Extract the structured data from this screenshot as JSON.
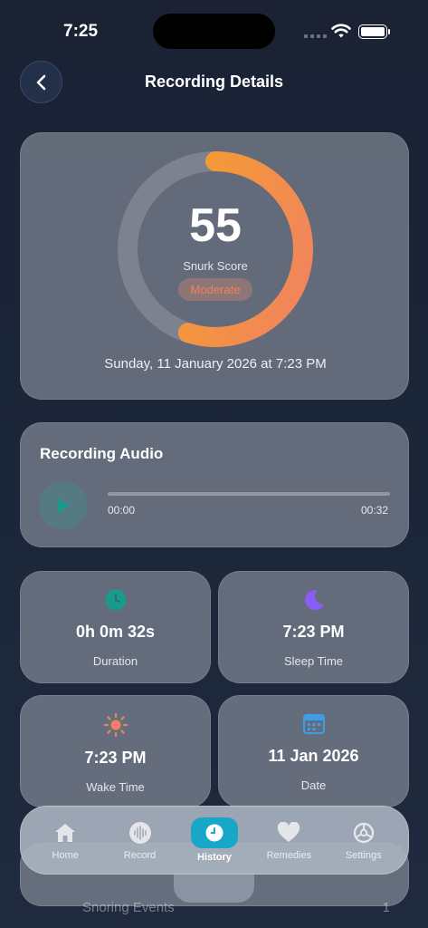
{
  "status_bar": {
    "time": "7:25"
  },
  "header": {
    "title": "Recording Details"
  },
  "score": {
    "value": "55",
    "label": "Snurk Score",
    "severity": "Moderate",
    "gauge_fraction": 0.55,
    "recorded_at": "Sunday, 11 January 2026 at 7:23 PM"
  },
  "audio": {
    "title": "Recording Audio",
    "current_time": "00:00",
    "total_time": "00:32",
    "progress": 0
  },
  "stats": [
    {
      "icon": "clock-icon",
      "value": "0h 0m 32s",
      "label": "Duration"
    },
    {
      "icon": "moon-icon",
      "value": "7:23 PM",
      "label": "Sleep Time"
    },
    {
      "icon": "sun-icon",
      "value": "7:23 PM",
      "label": "Wake Time"
    },
    {
      "icon": "calendar-icon",
      "value": "11 Jan 2026",
      "label": "Date"
    }
  ],
  "peek": {
    "label": "Snoring Events",
    "count": "1"
  },
  "tabbar": {
    "tabs": [
      {
        "icon": "home-icon",
        "label": "Home"
      },
      {
        "icon": "waveform-icon",
        "label": "Record"
      },
      {
        "icon": "clock-icon",
        "label": "History",
        "active": true
      },
      {
        "icon": "heart-icon",
        "label": "Remedies"
      },
      {
        "icon": "gear-icon",
        "label": "Settings"
      }
    ]
  },
  "colors": {
    "accent": "#19a7c7",
    "gauge_start": "#f0835f",
    "gauge_end": "#f7a02a",
    "moderate": "#f0835f",
    "moon": "#8b5cf6",
    "sun": "#f0835f",
    "calendar": "#3b9ee6",
    "duration": "#1a9a8c"
  }
}
